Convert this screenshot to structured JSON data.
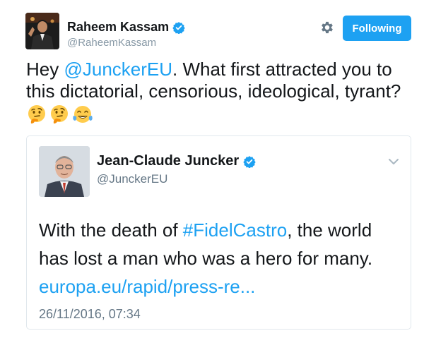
{
  "tweet": {
    "author_name": "Raheem Kassam",
    "author_handle": "@RaheemKassam",
    "follow_button_label": "Following",
    "text_prefix": "Hey ",
    "mention": "@JunckerEU",
    "text_suffix": ". What first attracted you to this dictatorial, censorious, ideological, tyrant?",
    "emojis": [
      "thinking-face",
      "thinking-face",
      "face-with-tears-of-joy"
    ]
  },
  "quoted_tweet": {
    "author_name": "Jean-Claude Juncker",
    "author_handle": "@JunckerEU",
    "text_prefix": "With the death of ",
    "hashtag": "#FidelCastro",
    "text_suffix": ", the world has lost a man who was a hero for many.",
    "link": "europa.eu/rapid/press-re...",
    "timestamp": "26/11/2016, 07:34"
  },
  "colors": {
    "accent": "#1da1f2",
    "text": "#14171a",
    "muted": "#657786",
    "border": "#e1e8ed"
  },
  "icons": [
    "verified-badge-icon",
    "gear-icon",
    "chevron-down-icon"
  ]
}
